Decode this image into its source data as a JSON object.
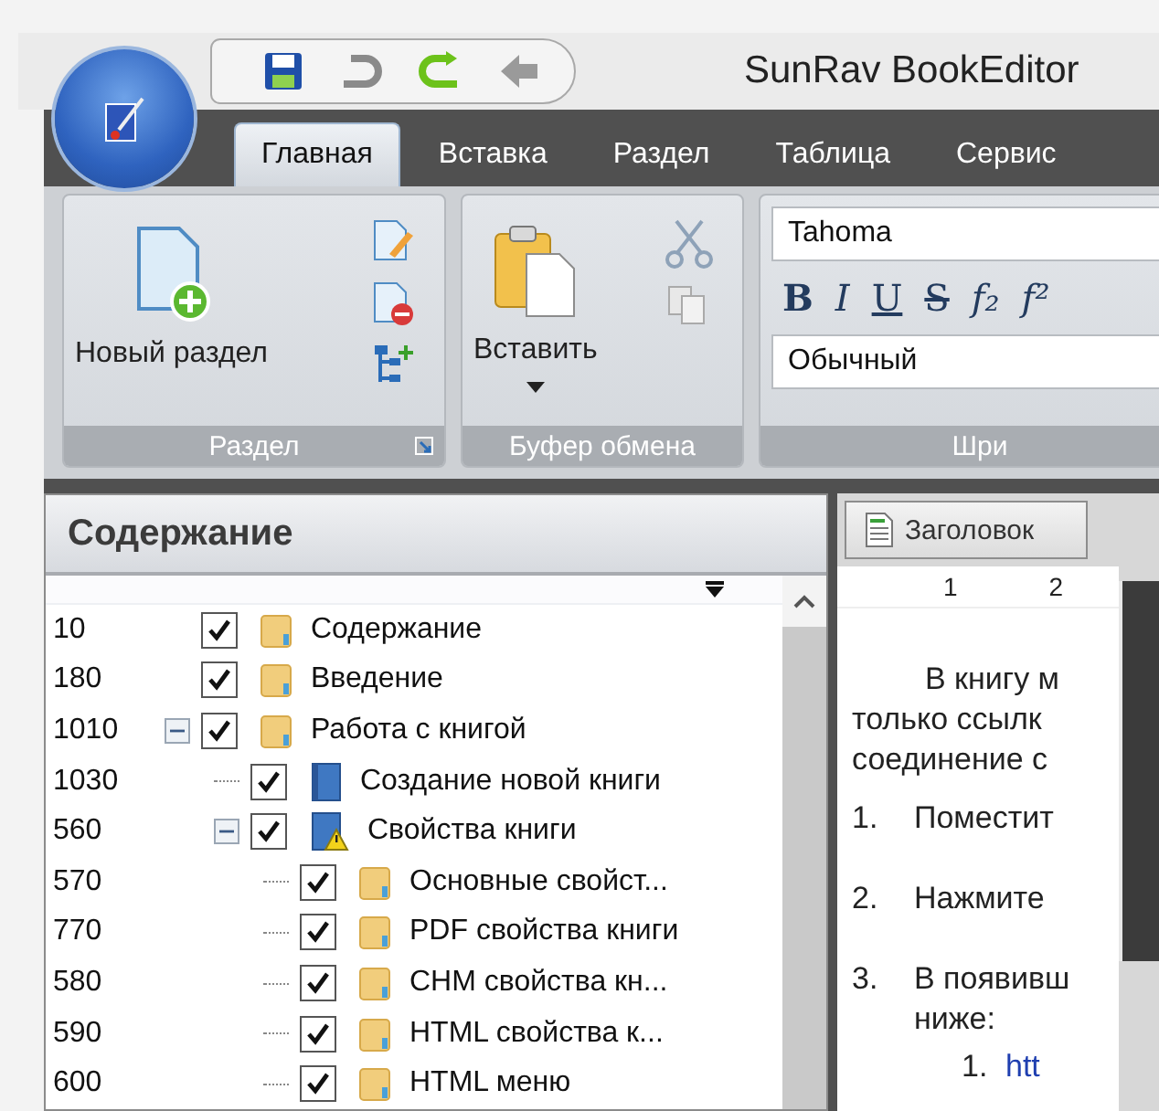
{
  "app": {
    "title": "SunRav BookEditor"
  },
  "tabs": [
    {
      "label": "Главная",
      "selected": true
    },
    {
      "label": "Вставка",
      "selected": false
    },
    {
      "label": "Раздел",
      "selected": false
    },
    {
      "label": "Таблица",
      "selected": false
    },
    {
      "label": "Сервис",
      "selected": false
    }
  ],
  "ribbon": {
    "groups": [
      {
        "kind": "section",
        "label": "Раздел",
        "big_button": "Новый раздел"
      },
      {
        "kind": "clipboard",
        "label": "Буфер обмена",
        "big_button": "Вставить"
      },
      {
        "kind": "font",
        "label": "Шри",
        "font": "Tahoma",
        "style": "Обычный",
        "format_buttons": [
          "B",
          "I",
          "U",
          "S",
          "f₂",
          "f²"
        ]
      }
    ]
  },
  "contents": {
    "title": "Содержание",
    "items": [
      {
        "number": "10",
        "label": "Содержание",
        "kind": "folder",
        "checked": true
      },
      {
        "number": "180",
        "label": "Введение",
        "kind": "folder",
        "checked": true
      },
      {
        "number": "1010",
        "label": "Работа с книгой",
        "kind": "folder",
        "checked": true,
        "expanded": true,
        "children": [
          {
            "number": "1030",
            "label": "Создание новой книги",
            "kind": "book",
            "checked": true
          },
          {
            "number": "560",
            "label": "Свойства книги",
            "kind": "warning",
            "checked": true,
            "expanded": true,
            "children": [
              {
                "number": "570",
                "label": "Основные свойст...",
                "kind": "folder",
                "checked": true
              },
              {
                "number": "770",
                "label": "PDF свойства книги",
                "kind": "folder",
                "checked": true
              },
              {
                "number": "580",
                "label": "CHM свойства кн...",
                "kind": "folder",
                "checked": true
              },
              {
                "number": "590",
                "label": "HTML свойства к...",
                "kind": "folder",
                "checked": true
              },
              {
                "number": "600",
                "label": "HTML меню",
                "kind": "folder",
                "checked": true
              }
            ]
          }
        ]
      }
    ]
  },
  "document": {
    "style_button": "Заголовок",
    "ruler_marks": [
      "1",
      "2"
    ],
    "paragraph": [
      "В книгу м",
      "только ссылк",
      "соединение с"
    ],
    "list": [
      {
        "number": "1.",
        "lines": [
          "Поместит"
        ]
      },
      {
        "number": "2.",
        "lines": [
          "Нажмите"
        ]
      },
      {
        "number": "3.",
        "lines": [
          "В появивш",
          "ниже:"
        ]
      }
    ],
    "sublist": [
      {
        "number": "1.",
        "text": "htt"
      }
    ]
  }
}
